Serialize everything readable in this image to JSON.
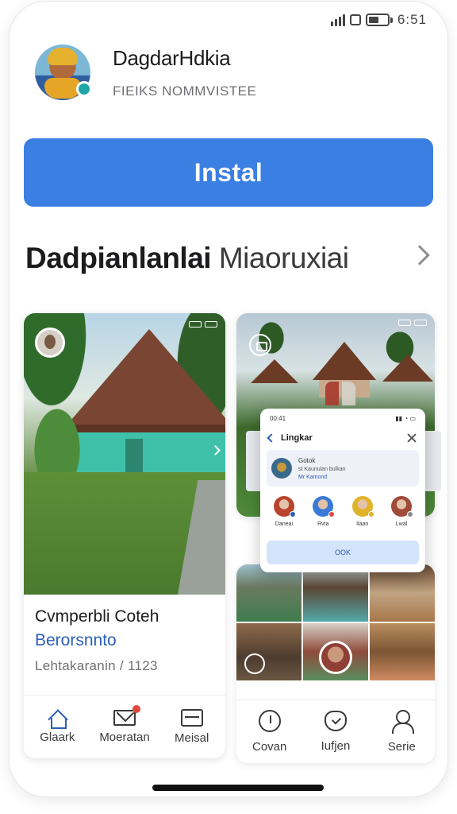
{
  "status_bar": {
    "time": "6:51"
  },
  "app": {
    "name": "DagdarHdkia",
    "subtitle": "FIEIKS NOMMVISTEE",
    "install_label": "Instal"
  },
  "section": {
    "title_bold": "Dadpianlanlai",
    "title_light": "Miaoruxiai"
  },
  "feature_card": {
    "title": "Cvmperbli Coteh",
    "author": "Berorsnnto",
    "meta": "Lehtakaranin / 1123",
    "nav": [
      {
        "label": "Glaark",
        "icon": "home-icon"
      },
      {
        "label": "Moeratan",
        "icon": "mail-icon"
      },
      {
        "label": "Meisal",
        "icon": "card-icon"
      }
    ]
  },
  "overlay": {
    "time": "00:41",
    "title": "Lingkar",
    "profile_line1": "Gotok",
    "profile_line2": "st Kaunulan bulkan",
    "profile_line3": "Mr Kamond",
    "contacts": [
      {
        "label": "Daneai",
        "color": "#b8442f",
        "dot": "#2b5fb8"
      },
      {
        "label": "Rvta",
        "color": "#3a7ad6",
        "dot": "#e2483b"
      },
      {
        "label": "Ilaan",
        "color": "#e0b32a",
        "dot": "#e0b32a"
      },
      {
        "label": "Lwal",
        "color": "#a04a3a",
        "dot": "#888888"
      }
    ],
    "button_label": "OOK"
  },
  "right_nav": [
    {
      "label": "Covan",
      "icon": "clock-icon"
    },
    {
      "label": "Iufjen",
      "icon": "heart-icon"
    },
    {
      "label": "Serie",
      "icon": "user-icon"
    }
  ],
  "colors": {
    "accent": "#3b7fe2",
    "link": "#2b5fb8",
    "notification": "#e2483b"
  }
}
